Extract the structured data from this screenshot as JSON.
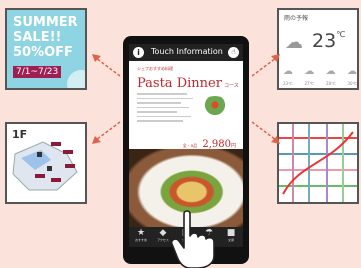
{
  "sale": {
    "line1": "SUMMER",
    "line2": "SALE!!",
    "line3": "50%OFF",
    "dates": "7/1~7/23"
  },
  "floor": {
    "label": "1F"
  },
  "weather": {
    "place": "雨の予報",
    "temp": "23",
    "unit": "℃",
    "rows": [
      "23℃",
      "27℃",
      "28℃",
      "30℃"
    ]
  },
  "tablet": {
    "header": "Touch Information",
    "menu": {
      "kicker": "シェフおすすめ料理",
      "title": "Pasta Dinner",
      "subtitle": "コース",
      "price": "2,980",
      "price_unit": "円",
      "price_prefix": "全・8品"
    },
    "nav": [
      {
        "icon": "★",
        "label": "おすすめ"
      },
      {
        "icon": "◆",
        "label": "アクセス"
      },
      {
        "icon": "▣",
        "label": "フロア"
      },
      {
        "icon": "☂",
        "label": "天気"
      },
      {
        "icon": "■",
        "label": "交通"
      }
    ]
  },
  "colors": {
    "accent": "#c0272d",
    "bg": "#fbe3dc",
    "sale_bg": "#7fd0e0",
    "sale_date_bg": "#a01f53"
  }
}
